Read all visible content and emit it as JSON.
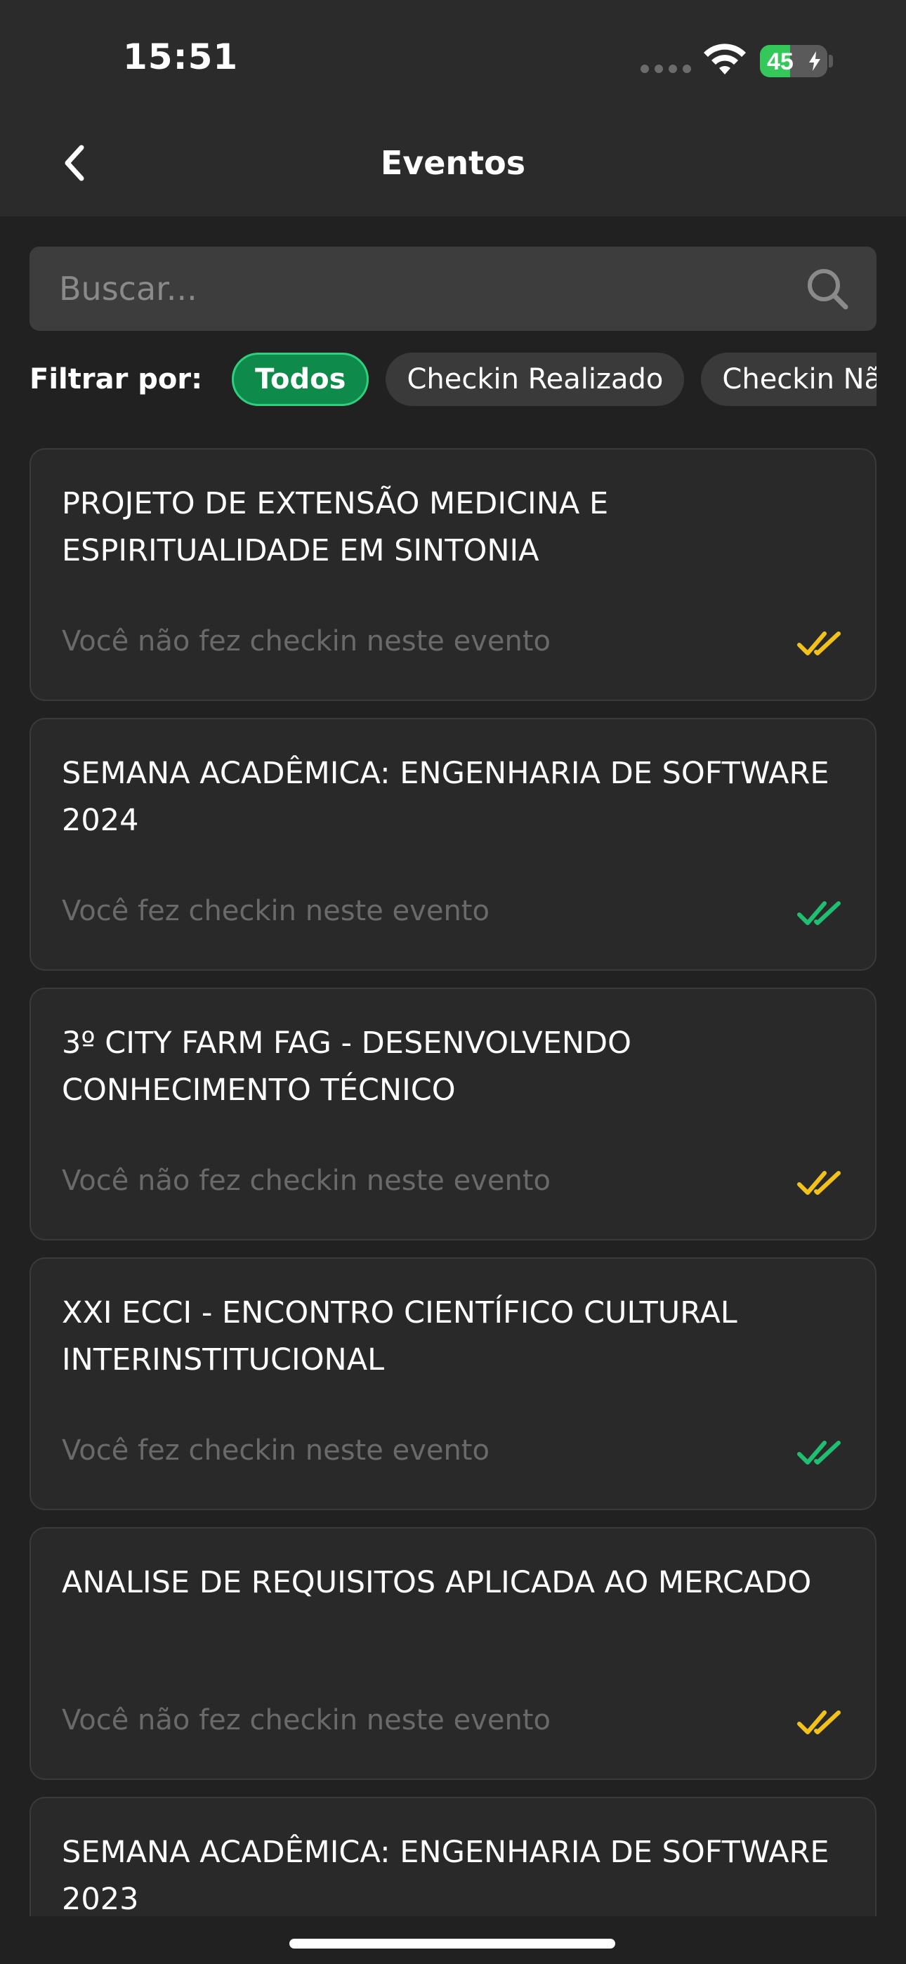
{
  "status_bar": {
    "time": "15:51",
    "battery_level": "45",
    "battery_percent": 45,
    "battery_color": "#34c759"
  },
  "nav": {
    "title": "Eventos",
    "back_icon": "chevron-left-icon"
  },
  "search": {
    "placeholder": "Buscar...",
    "value": "",
    "icon": "search-icon"
  },
  "filter": {
    "label": "Filtrar por:",
    "options": [
      {
        "label": "Todos",
        "active": true
      },
      {
        "label": "Checkin Realizado",
        "active": false
      },
      {
        "label": "Checkin Não Realizado",
        "active": false
      }
    ],
    "active_color": "#0e8a4a"
  },
  "events": [
    {
      "title": "PROJETO DE EXTENSÃO MEDICINA E ESPIRITUALIDADE EM SINTONIA",
      "status": "Você não fez checkin neste evento",
      "checked_in": false
    },
    {
      "title": "SEMANA ACADÊMICA: ENGENHARIA DE SOFTWARE 2024",
      "status": "Você fez checkin neste evento",
      "checked_in": true
    },
    {
      "title": "3º CITY FARM FAG - DESENVOLVENDO CONHECIMENTO TÉCNICO",
      "status": "Você não fez checkin neste evento",
      "checked_in": false
    },
    {
      "title": "XXI ECCI - ENCONTRO CIENTÍFICO CULTURAL INTERINSTITUCIONAL",
      "status": "Você fez checkin neste evento",
      "checked_in": true
    },
    {
      "title": "ANALISE DE REQUISITOS APLICADA AO MERCADO",
      "status": "Você não fez checkin neste evento",
      "checked_in": false
    },
    {
      "title": "SEMANA ACADÊMICA: ENGENHARIA DE SOFTWARE 2023",
      "status": "",
      "checked_in": null
    }
  ],
  "colors": {
    "checked_in": "#1fbf72",
    "not_checked_in": "#f2c21b"
  }
}
